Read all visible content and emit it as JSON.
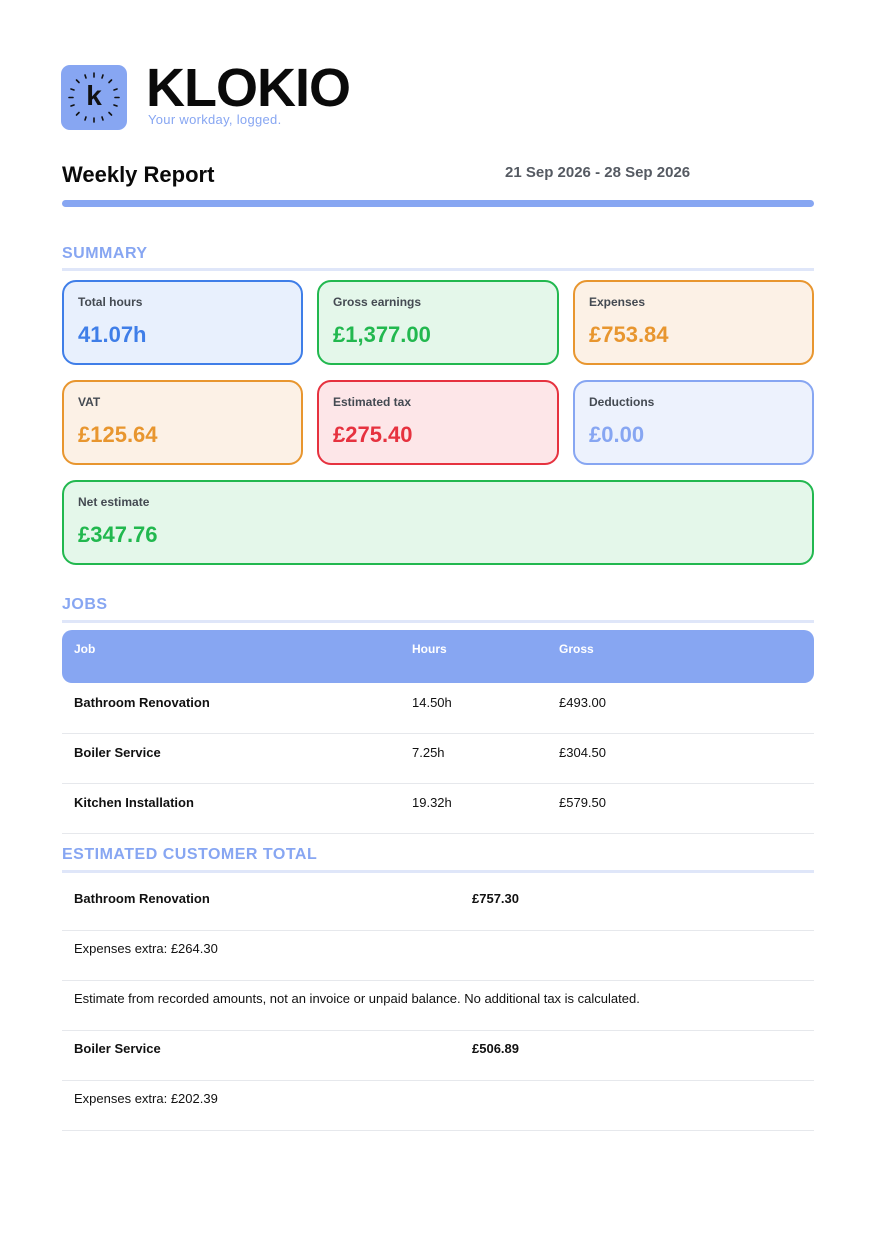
{
  "brand": {
    "name": "KLOKIO",
    "logo_letter": "k",
    "tagline": "Your workday, logged.",
    "accent_color": "#87a6f2"
  },
  "report": {
    "title": "Weekly Report",
    "date_range": "21 Sep 2026 - 28 Sep 2026"
  },
  "summary": {
    "section_title": "SUMMARY",
    "cards": [
      {
        "label": "Total hours",
        "value": "41.07h"
      },
      {
        "label": "Gross earnings",
        "value": "£1,377.00"
      },
      {
        "label": "Expenses",
        "value": "£753.84"
      },
      {
        "label": "VAT",
        "value": "£125.64"
      },
      {
        "label": "Estimated tax",
        "value": "£275.40"
      },
      {
        "label": "Deductions",
        "value": "£0.00"
      },
      {
        "label": "Net estimate",
        "value": "£347.76"
      }
    ]
  },
  "jobs": {
    "section_title": "JOBS",
    "columns": [
      "Job",
      "Hours",
      "Gross"
    ],
    "rows": [
      {
        "job": "Bathroom Renovation",
        "hours": "14.50h",
        "gross": "£493.00"
      },
      {
        "job": "Boiler Service",
        "hours": "7.25h",
        "gross": "£304.50"
      },
      {
        "job": "Kitchen Installation",
        "hours": "19.32h",
        "gross": "£579.50"
      }
    ]
  },
  "customer_total": {
    "section_title": "ESTIMATED CUSTOMER TOTAL",
    "rows": [
      {
        "text": "Bathroom Renovation",
        "amount": "£757.30"
      },
      {
        "text": "Expenses extra: £264.30"
      },
      {
        "text": "Estimate from recorded amounts, not an invoice or unpaid balance. No additional tax is calculated."
      },
      {
        "text": "Boiler Service",
        "amount": "£506.89"
      },
      {
        "text": "Expenses extra: £202.39"
      }
    ]
  }
}
